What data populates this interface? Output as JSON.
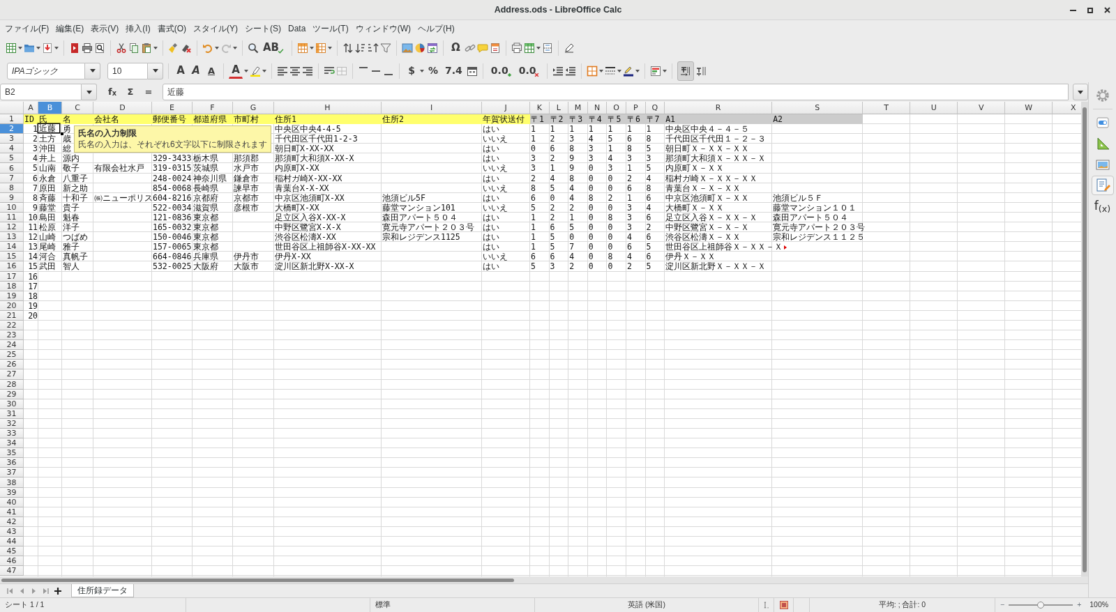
{
  "window": {
    "title": "Address.ods - LibreOffice Calc"
  },
  "menu": [
    "ファイル(F)",
    "編集(E)",
    "表示(V)",
    "挿入(I)",
    "書式(O)",
    "スタイル(Y)",
    "シート(S)",
    "Data",
    "ツール(T)",
    "ウィンドウ(W)",
    "ヘルプ(H)"
  ],
  "standard_toolbar": {
    "glyphs": [
      "AB",
      "Ω"
    ]
  },
  "formatting_toolbar": {
    "font_name": "IPAゴシック",
    "font_size": "10",
    "glyphs": [
      "A",
      "A",
      "A",
      "A",
      "$",
      "%",
      "7.4",
      "0.0",
      "0.0"
    ],
    "text_direction_pressed": true
  },
  "formula_bar": {
    "name_box": "B2",
    "glyphs": [
      "f$_{x}$",
      "Σ",
      "="
    ],
    "content": "近藤"
  },
  "sheet": {
    "columns": [
      {
        "label": "A",
        "selected": false
      },
      {
        "label": "B",
        "selected": true
      },
      {
        "label": "C",
        "selected": false
      },
      {
        "label": "D",
        "selected": false
      },
      {
        "label": "E",
        "selected": false
      },
      {
        "label": "F",
        "selected": false
      },
      {
        "label": "G",
        "selected": false
      },
      {
        "label": "H",
        "selected": false
      },
      {
        "label": "I",
        "selected": false
      },
      {
        "label": "J",
        "selected": false
      },
      {
        "label": "K",
        "selected": false
      },
      {
        "label": "L",
        "selected": false
      },
      {
        "label": "M",
        "selected": false
      },
      {
        "label": "N",
        "selected": false
      },
      {
        "label": "O",
        "selected": false
      },
      {
        "label": "P",
        "selected": false
      },
      {
        "label": "Q",
        "selected": false
      },
      {
        "label": "R",
        "selected": false
      },
      {
        "label": "S",
        "selected": false
      },
      {
        "label": "T",
        "selected": false
      },
      {
        "label": "U",
        "selected": false
      },
      {
        "label": "V",
        "selected": false
      },
      {
        "label": "W",
        "selected": false
      },
      {
        "label": "X",
        "selected": false
      }
    ],
    "rows": [
      {
        "label": "1",
        "selected": false,
        "cells": [
          {
            "text": "ID",
            "color": "#ffff6d"
          },
          {
            "text": "氏",
            "color": "#ffff6d"
          },
          {
            "text": "名",
            "color": "#ffff6d"
          },
          {
            "text": "会社名",
            "color": "#ffff6d"
          },
          {
            "text": "郵便番号",
            "color": "#ffff6d"
          },
          {
            "text": "都道府県",
            "color": "#ffff6d"
          },
          {
            "text": "市町村",
            "color": "#ffff6d"
          },
          {
            "text": "住所1",
            "color": "#ffff6d"
          },
          {
            "text": "住所2",
            "color": "#ffff6d"
          },
          {
            "text": "年賀状送付",
            "color": "#ffff6d"
          },
          {
            "text": "〒1",
            "color": "#cccccc"
          },
          {
            "text": "〒2",
            "color": "#cccccc"
          },
          {
            "text": "〒3",
            "color": "#cccccc"
          },
          {
            "text": "〒4",
            "color": "#cccccc"
          },
          {
            "text": "〒5",
            "color": "#cccccc"
          },
          {
            "text": "〒6",
            "color": "#cccccc"
          },
          {
            "text": "〒7",
            "color": "#cccccc"
          },
          {
            "text": "A1",
            "color": "#cccccc"
          },
          {
            "text": "A2",
            "color": "#cccccc"
          }
        ]
      },
      {
        "label": "2",
        "selected": true,
        "cells": [
          "1",
          "近藤",
          "勇",
          null,
          null,
          null,
          null,
          "中央区中央4-4-5",
          null,
          "はい",
          "1",
          "1",
          "1",
          "1",
          "1",
          "1",
          "1",
          "中央区中央４－４－５"
        ]
      },
      {
        "label": "3",
        "selected": false,
        "cells": [
          "2",
          "土方",
          "歳",
          null,
          null,
          null,
          null,
          "千代田区千代田1-2-3",
          null,
          "いいえ",
          "1",
          "2",
          "3",
          "4",
          "5",
          "6",
          "8",
          "千代田区千代田１－２－３"
        ]
      },
      {
        "label": "4",
        "selected": false,
        "cells": [
          "3",
          "沖田",
          "総",
          null,
          null,
          null,
          null,
          "朝日町X-XX-XX",
          null,
          "はい",
          "0",
          "6",
          "8",
          "3",
          "1",
          "8",
          "5",
          "朝日町Ｘ－ＸＸ－ＸＸ"
        ]
      },
      {
        "label": "5",
        "selected": false,
        "cells": [
          "4",
          "井上",
          "源内",
          null,
          "329-3433",
          "栃木県",
          "那須郡",
          "那須町大和須X-XX-X",
          null,
          "はい",
          "3",
          "2",
          "9",
          "3",
          "4",
          "3",
          "3",
          "那須町大和須Ｘ－ＸＸ－Ｘ"
        ]
      },
      {
        "label": "6",
        "selected": false,
        "cells": [
          "5",
          "山南",
          "敬子",
          "有限会社水戸",
          "319-0315",
          "茨城県",
          "水戸市",
          "内原町X-XX",
          null,
          "いいえ",
          "3",
          "1",
          "9",
          "0",
          "3",
          "1",
          "5",
          "内原町Ｘ－ＸＸ"
        ]
      },
      {
        "label": "7",
        "selected": false,
        "cells": [
          "6",
          "永倉",
          "八重子",
          null,
          "248-0024",
          "神奈川県",
          "鎌倉市",
          "稲村ガ崎X-XX-XX",
          null,
          "はい",
          "2",
          "4",
          "8",
          "0",
          "0",
          "2",
          "4",
          "稲村ガ崎Ｘ－ＸＸ－ＸＸ"
        ]
      },
      {
        "label": "8",
        "selected": false,
        "cells": [
          "7",
          "原田",
          "新之助",
          null,
          "854-0068",
          "長崎県",
          "諫早市",
          "青葉台X-X-XX",
          null,
          "いいえ",
          "8",
          "5",
          "4",
          "0",
          "0",
          "6",
          "8",
          "青葉台Ｘ－Ｘ－ＸＸ"
        ]
      },
      {
        "label": "9",
        "selected": false,
        "cells": [
          "8",
          "斉藤",
          "十和子",
          "㈱ニューポリス",
          "604-8216",
          "京都府",
          "京都市",
          "中京区池須町X-XX",
          "池須ビル5F",
          "はい",
          "6",
          "0",
          "4",
          "8",
          "2",
          "1",
          "6",
          "中京区池須町Ｘ－ＸＸ",
          "池須ビル５Ｆ"
        ]
      },
      {
        "label": "10",
        "selected": false,
        "cells": [
          "9",
          "藤堂",
          "貴子",
          null,
          "522-0034",
          "滋賀県",
          "彦根市",
          "大橋町X-XX",
          "藤堂マンション101",
          "いいえ",
          "5",
          "2",
          "2",
          "0",
          "0",
          "3",
          "4",
          "大橋町Ｘ－ＸＸ",
          "藤堂マンション１０１"
        ]
      },
      {
        "label": "11",
        "selected": false,
        "cells": [
          "10",
          "島田",
          "魁春",
          null,
          "121-0836",
          "東京都",
          null,
          "足立区入谷X-XX-X",
          "森田アパート５０４",
          "はい",
          "1",
          "2",
          "1",
          "0",
          "8",
          "3",
          "6",
          "足立区入谷Ｘ－ＸＸ－Ｘ",
          "森田アパート５０４"
        ]
      },
      {
        "label": "12",
        "selected": false,
        "cells": [
          "11",
          "松原",
          "洋子",
          null,
          "165-0032",
          "東京都",
          null,
          "中野区鷺宮X-X-X",
          "寛元寺アパート２０３号",
          "はい",
          "1",
          "6",
          "5",
          "0",
          "0",
          "3",
          "2",
          "中野区鷺宮Ｘ－Ｘ－Ｘ",
          "寛元寺アパート２０３号"
        ]
      },
      {
        "label": "13",
        "selected": false,
        "cells": [
          "12",
          "山崎",
          "つばめ",
          null,
          "150-0046",
          "東京都",
          null,
          "渋谷区松濤X-XX",
          "宗和レジデンス1125",
          "はい",
          "1",
          "5",
          "0",
          "0",
          "0",
          "4",
          "6",
          "渋谷区松濤Ｘ－ＸＸ",
          "宗和レジデンス１１２５"
        ]
      },
      {
        "label": "14",
        "selected": false,
        "cells": [
          "13",
          "尾崎",
          "雅子",
          null,
          "157-0065",
          "東京都",
          null,
          "世田谷区上祖師谷X-XX-XX",
          null,
          "はい",
          "1",
          "5",
          "7",
          "0",
          "0",
          "6",
          "5",
          {
            "text": "世田谷区上祖師谷Ｘ－ＸＸ－Ｘ",
            "clipped": true
          }
        ]
      },
      {
        "label": "15",
        "selected": false,
        "cells": [
          "14",
          "河合",
          "真帆子",
          null,
          "664-0846",
          "兵庫県",
          "伊丹市",
          "伊丹X-XX",
          null,
          "いいえ",
          "6",
          "6",
          "4",
          "0",
          "8",
          "4",
          "6",
          "伊丹Ｘ－ＸＸ"
        ]
      },
      {
        "label": "16",
        "selected": false,
        "cells": [
          "15",
          "武田",
          "智人",
          null,
          "532-0025",
          "大阪府",
          "大阪市",
          "淀川区新北野X-XX-X",
          null,
          "はい",
          "5",
          "3",
          "2",
          "0",
          "0",
          "2",
          "5",
          "淀川区新北野Ｘ－ＸＸ－Ｘ"
        ]
      },
      {
        "label": "17",
        "selected": false,
        "cells": [
          "16"
        ]
      },
      {
        "label": "18",
        "selected": false,
        "cells": [
          "17"
        ]
      },
      {
        "label": "19",
        "selected": false,
        "cells": [
          "18"
        ]
      },
      {
        "label": "20",
        "selected": false,
        "cells": [
          "19"
        ]
      },
      {
        "label": "21",
        "selected": false,
        "cells": [
          "20"
        ]
      },
      {
        "label": "22",
        "selected": false
      },
      {
        "label": "23",
        "selected": false
      },
      {
        "label": "24",
        "selected": false
      },
      {
        "label": "25",
        "selected": false
      },
      {
        "label": "26",
        "selected": false
      },
      {
        "label": "27",
        "selected": false
      },
      {
        "label": "28",
        "selected": false
      },
      {
        "label": "29",
        "selected": false
      },
      {
        "label": "30",
        "selected": false
      },
      {
        "label": "31",
        "selected": false
      },
      {
        "label": "32",
        "selected": false
      },
      {
        "label": "33",
        "selected": false
      },
      {
        "label": "34",
        "selected": false
      },
      {
        "label": "35",
        "selected": false
      },
      {
        "label": "36",
        "selected": false
      },
      {
        "label": "37",
        "selected": false
      },
      {
        "label": "38",
        "selected": false
      },
      {
        "label": "39",
        "selected": false
      },
      {
        "label": "40",
        "selected": false
      },
      {
        "label": "41",
        "selected": false
      },
      {
        "label": "42",
        "selected": false
      },
      {
        "label": "43",
        "selected": false
      },
      {
        "label": "44",
        "selected": false
      },
      {
        "label": "45",
        "selected": false
      },
      {
        "label": "46",
        "selected": false
      },
      {
        "label": "47",
        "selected": false
      }
    ]
  },
  "tooltip": {
    "title": "氏名の入力制限",
    "message": "氏名の入力は、それぞれ6文字以下に制限されます"
  },
  "sheet_tabs": [
    {
      "label": "住所録データ",
      "selected": true
    }
  ],
  "sidebar": [
    {
      "kind": "settings",
      "selected": false
    },
    {
      "kind": "properties",
      "selected": false
    },
    {
      "kind": "styles",
      "selected": false
    },
    {
      "kind": "gallery",
      "selected": false
    },
    {
      "kind": "navigator",
      "selected": true
    },
    {
      "kind": "functions",
      "label": "f$_{(x)}$",
      "selected": false
    }
  ],
  "status_bar": {
    "sheet": "シート 1 / 1",
    "style": "標準",
    "language": "英語 (米国)",
    "summary": "平均: ; 合計: 0",
    "zoom_out": "−",
    "zoom_in": "+",
    "zoom": {
      "level": 0.5
    },
    "zoom_percent": "100%"
  }
}
